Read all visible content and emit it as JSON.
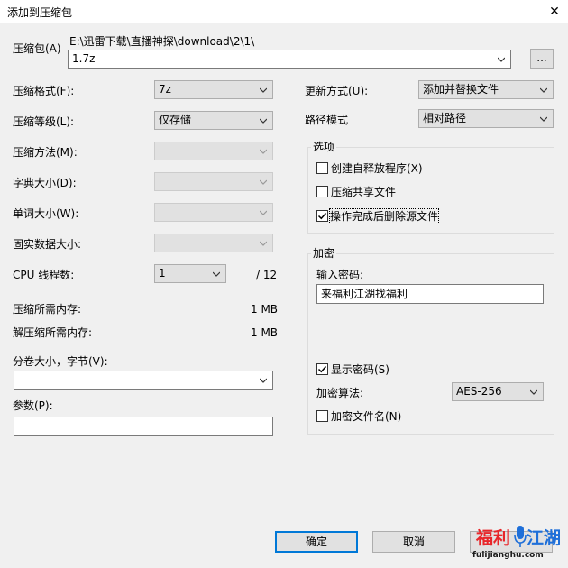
{
  "window": {
    "title": "添加到压缩包",
    "close_glyph": "✕"
  },
  "archive": {
    "label": "压缩包(A)",
    "path": "E:\\迅雷下载\\直播神探\\download\\2\\1\\",
    "filename": "1.7z",
    "browse_label": "..."
  },
  "left": {
    "format_label": "压缩格式(F):",
    "format_value": "7z",
    "level_label": "压缩等级(L):",
    "level_value": "仅存储",
    "method_label": "压缩方法(M):",
    "method_value": "",
    "dict_label": "字典大小(D):",
    "dict_value": "",
    "word_label": "单词大小(W):",
    "word_value": "",
    "solid_label": "固实数据大小:",
    "solid_value": "",
    "threads_label": "CPU 线程数:",
    "threads_value": "1",
    "threads_total": "/ 12",
    "mem_compress_label": "压缩所需内存:",
    "mem_compress_value": "1 MB",
    "mem_decompress_label": "解压缩所需内存:",
    "mem_decompress_value": "1 MB",
    "split_label": "分卷大小，字节(V):",
    "split_value": "",
    "params_label": "参数(P):",
    "params_value": ""
  },
  "right": {
    "update_label": "更新方式(U):",
    "update_value": "添加并替换文件",
    "path_label": "路径模式",
    "path_value": "相对路径",
    "options": {
      "title": "选项",
      "items": [
        {
          "label": "创建自释放程序(X)",
          "checked": false
        },
        {
          "label": "压缩共享文件",
          "checked": false
        },
        {
          "label": "操作完成后删除源文件",
          "checked": true
        }
      ]
    },
    "encryption": {
      "title": "加密",
      "password_label": "输入密码:",
      "password_value": "来福利江湖找福利",
      "show_password_label": "显示密码(S)",
      "show_password_checked": true,
      "algo_label": "加密算法:",
      "algo_value": "AES-256",
      "encrypt_names_label": "加密文件名(N)",
      "encrypt_names_checked": false
    }
  },
  "buttons": {
    "ok": "确定",
    "cancel": "取消"
  },
  "watermark": {
    "text_left": "福利",
    "text_right": "江湖",
    "url": "fulijianghu.com"
  },
  "colors": {
    "accent": "#0078d7",
    "wm_red": "#e8262a",
    "wm_blue": "#1e6fd9"
  }
}
